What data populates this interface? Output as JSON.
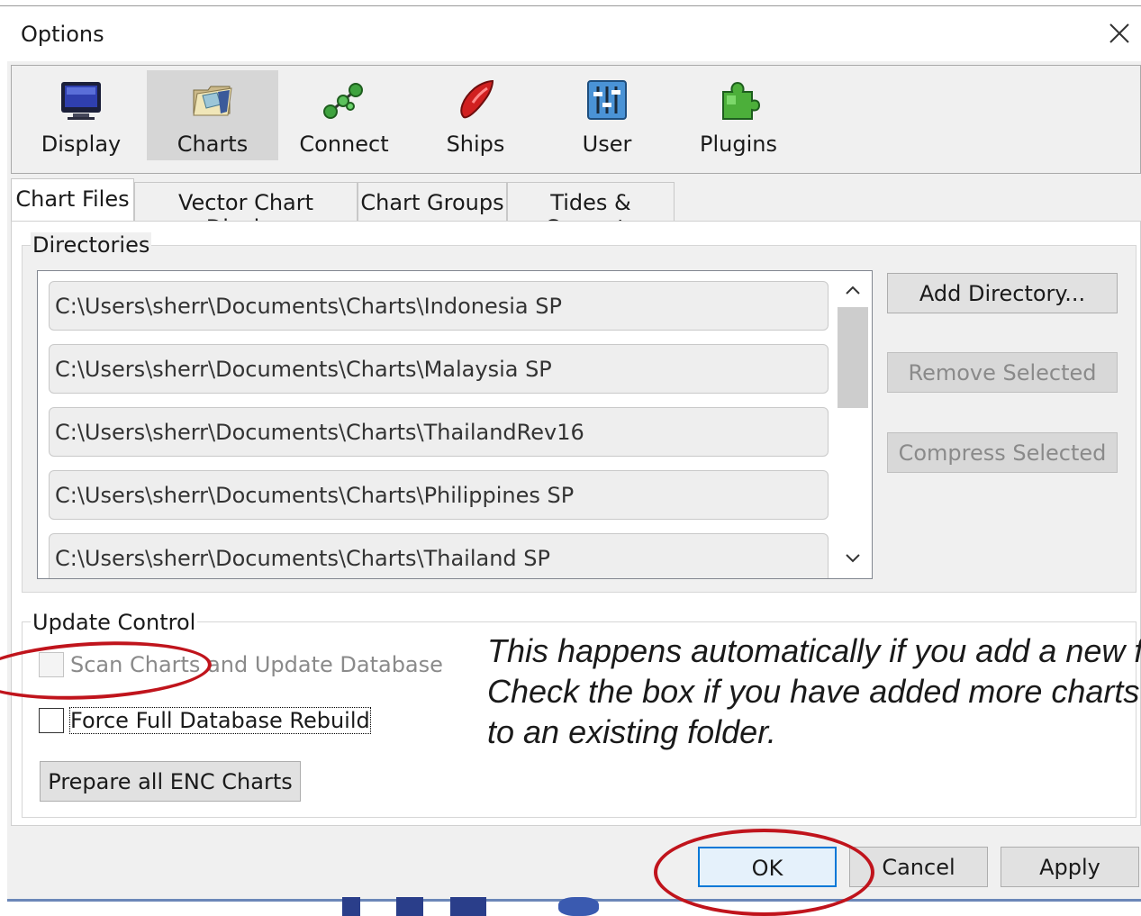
{
  "window": {
    "title": "Options",
    "close_icon": "close-icon"
  },
  "toolbar": {
    "items": [
      {
        "label": "Display",
        "icon": "monitor-icon"
      },
      {
        "label": "Charts",
        "icon": "chart-folder-icon",
        "active": true
      },
      {
        "label": "Connect",
        "icon": "network-nodes-icon"
      },
      {
        "label": "Ships",
        "icon": "boat-icon"
      },
      {
        "label": "User",
        "icon": "sliders-icon"
      },
      {
        "label": "Plugins",
        "icon": "puzzle-piece-icon"
      }
    ]
  },
  "tabs": [
    {
      "label": "Chart Files",
      "active": true
    },
    {
      "label": "Vector Chart Display"
    },
    {
      "label": "Chart Groups"
    },
    {
      "label": "Tides & Currents"
    }
  ],
  "directories": {
    "title": "Directories",
    "items": [
      "C:\\Users\\sherr\\Documents\\Charts\\Indonesia SP",
      "C:\\Users\\sherr\\Documents\\Charts\\Malaysia SP",
      "C:\\Users\\sherr\\Documents\\Charts\\ThailandRev16",
      "C:\\Users\\sherr\\Documents\\Charts\\Philippines SP",
      "C:\\Users\\sherr\\Documents\\Charts\\Thailand SP"
    ],
    "add_label": "Add Directory...",
    "remove_label": "Remove Selected",
    "compress_label": "Compress Selected"
  },
  "update_control": {
    "title": "Update Control",
    "scan_label": "Scan Charts and Update Database",
    "scan_checked": false,
    "scan_enabled": false,
    "force_label": "Force Full Database Rebuild",
    "force_checked": false,
    "prepare_label": "Prepare all ENC Charts"
  },
  "annotation": {
    "lines": [
      "This happens automatically if you add a new folder.",
      "Check the box if you have added more charts",
      "to an existing folder."
    ],
    "highlight_color": "#c0141c"
  },
  "footer": {
    "ok_label": "OK",
    "cancel_label": "Cancel",
    "apply_label": "Apply"
  },
  "colors": {
    "accent": "#0078d7",
    "annotation_red": "#c0141c",
    "dialog_bg": "#f0f0f0"
  }
}
